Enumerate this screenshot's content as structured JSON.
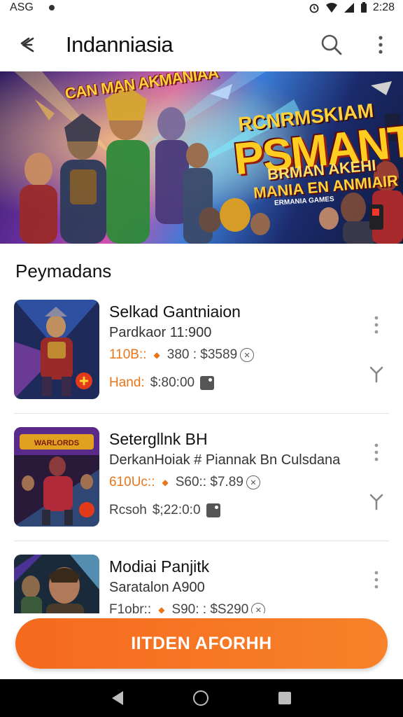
{
  "status_bar": {
    "left_text": "ASG",
    "time": "2:28"
  },
  "header": {
    "title": "Indanniasia"
  },
  "banner": {
    "line1": "CAN MAN AKMANIAA",
    "line2": "RCNRMSKIAM",
    "line3": "PSMANT",
    "line4": "BRMAN AKEHI",
    "line5": "MANIA EN ANMIAIR",
    "line6": "ERMANIA GAMES"
  },
  "section": {
    "title": "Peymadans"
  },
  "items": [
    {
      "title": "Selkad Gantniaion",
      "subtitle": "Pardkaor 11:900",
      "price_old": "110B::",
      "price_mid": "380 : $3589",
      "bid_label": "Hand:",
      "bid_value": "$:80:00"
    },
    {
      "title": "Setergllnk BH",
      "subtitle": "DerkanHoiak # Piannak Bn Culsdana",
      "price_old": "610Uc::",
      "price_mid": "S60:: $7.89",
      "bid_label": "Rcsoh",
      "bid_value": "$;22:0:0"
    },
    {
      "title": "Modiai Panjitk",
      "subtitle": "Saratalon A900",
      "price_old": "F1obr::",
      "price_mid": "S90: : $S290",
      "bid_label": "",
      "bid_value": ""
    }
  ],
  "cta": {
    "label": "IITDEN AFORHH"
  },
  "icons": {
    "back": "back-arrow-icon",
    "search": "search-icon",
    "more": "more-vert-icon",
    "info": "info-icon",
    "tag": "tag-icon",
    "expand": "expand-icon"
  },
  "colors": {
    "accent": "#f66a1e",
    "price": "#e8751a"
  }
}
